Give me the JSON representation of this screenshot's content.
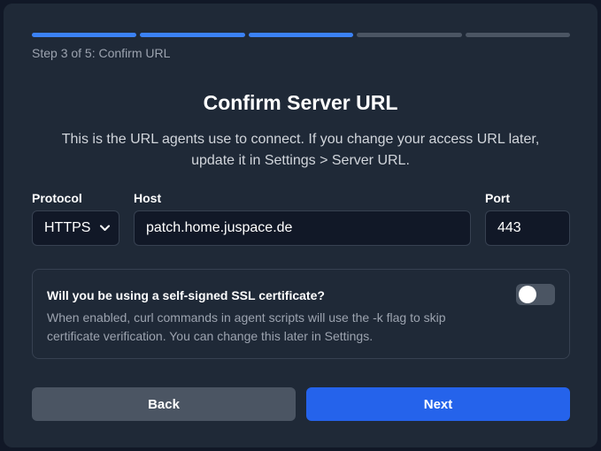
{
  "wizard": {
    "progress": {
      "current_step": 3,
      "total_steps": 5
    },
    "step_text": "Step 3 of 5: Confirm URL"
  },
  "content": {
    "title": "Confirm Server URL",
    "description": "This is the URL agents use to connect. If you change your access URL later, update it in Settings > Server URL."
  },
  "form": {
    "protocol_label": "Protocol",
    "protocol_value": "HTTPS",
    "host_label": "Host",
    "host_value": "patch.home.juspace.de",
    "port_label": "Port",
    "port_value": "443"
  },
  "ssl": {
    "question": "Will you be using a self-signed SSL certificate?",
    "help": "When enabled, curl commands in agent scripts will use the -k flag to skip certificate verification. You can change this later in Settings.",
    "enabled": false
  },
  "buttons": {
    "back": "Back",
    "next": "Next"
  },
  "colors": {
    "accent": "#3b82f6",
    "primary_button": "#2563eb",
    "secondary_button": "#4b5563",
    "card": "#1f2937",
    "background": "#111827"
  },
  "icons": {
    "protocol_dropdown": "chevron-down-icon"
  }
}
